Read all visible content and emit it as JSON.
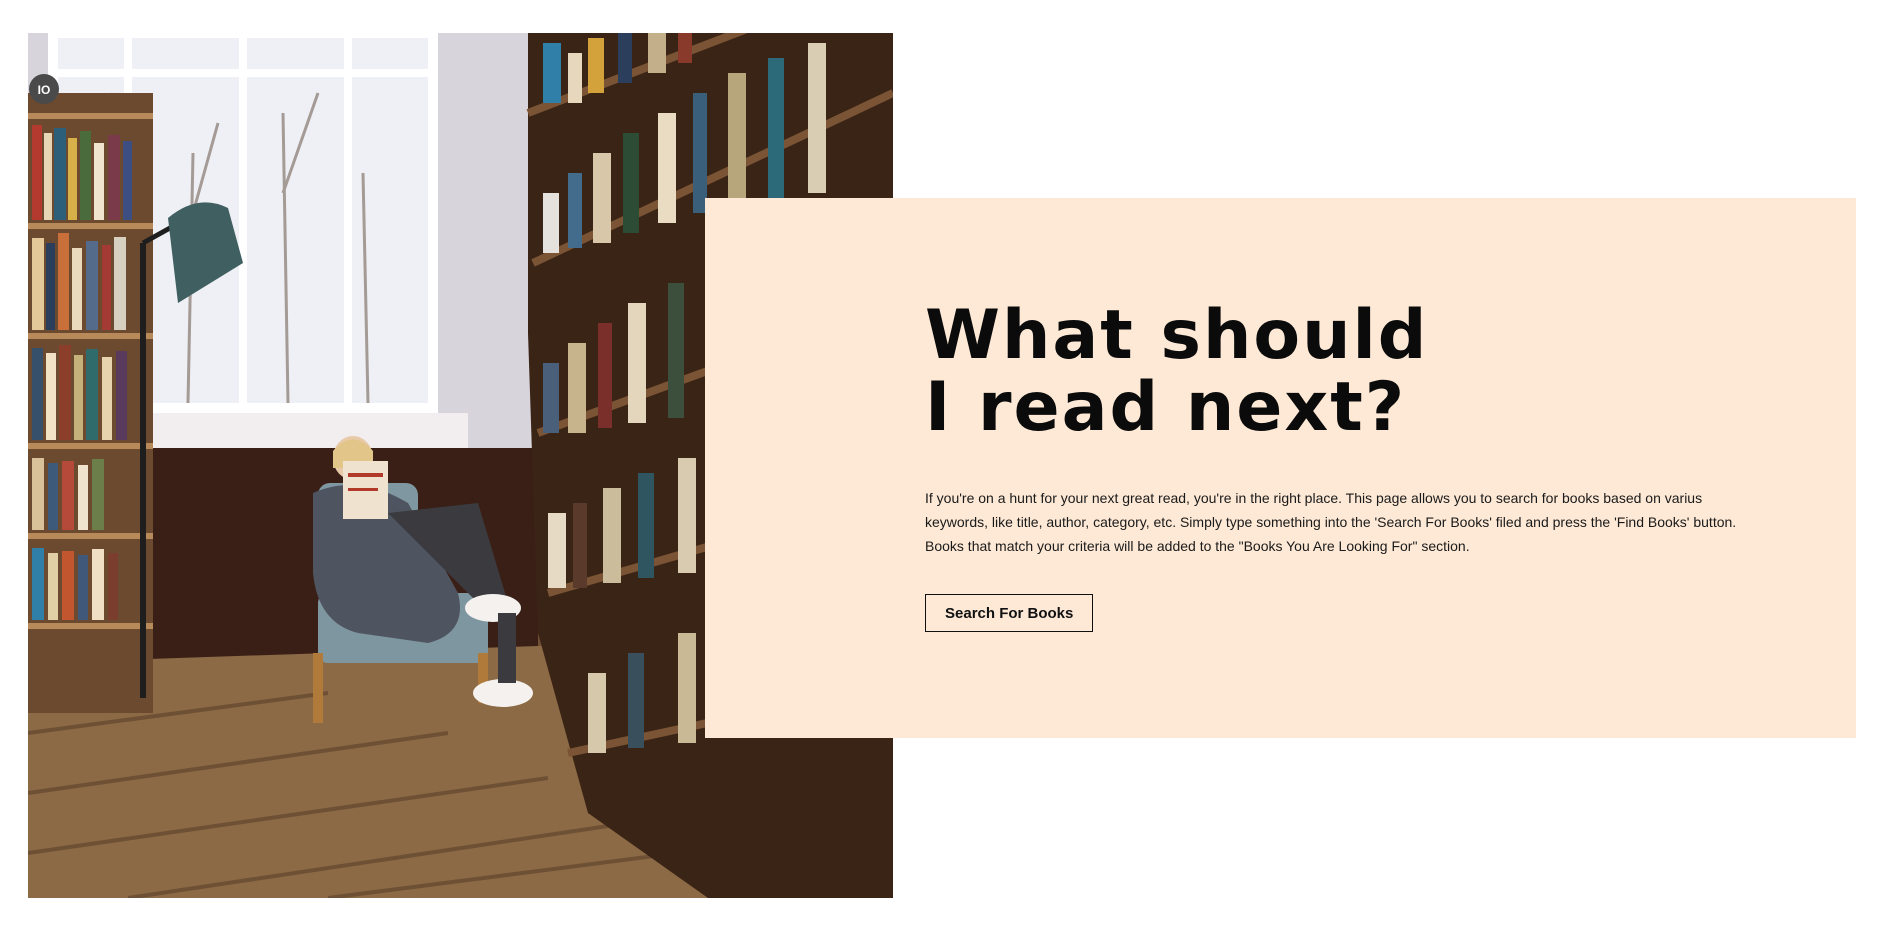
{
  "hero": {
    "image_alt": "Person reading a book in a library chair",
    "headline_line1": "What should",
    "headline_line2": "I read next?",
    "description": "If you're on a hunt for your next great read, you're in the right place. This page allows you to search for books based on varius keywords, like title, author, category, etc. Simply type something into the 'Search For Books' filed and press the 'Find Books' button. Books that match your criteria will be added to the \"Books You Are Looking For\" section.",
    "button_label": "Search For Books",
    "photo_badge": "IO"
  },
  "colors": {
    "panel_background": "#fde9d6",
    "text": "#0b0b0b",
    "page_background": "#ffffff"
  }
}
